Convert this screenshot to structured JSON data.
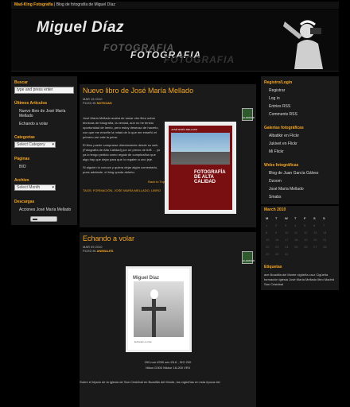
{
  "topbar": {
    "brand": "Mad-King Fotografía",
    "sep": " | ",
    "tagline": "Blog de fotografía de Miguel Díaz"
  },
  "header": {
    "name": "Miguel Díaz",
    "sub": "FOTOGRAFIA"
  },
  "left": {
    "search_title": "Buscar",
    "search_placeholder": "type and press enter",
    "recent_title": "Últimos Artículos",
    "recent": [
      "Nuevo libro de José María Mellado",
      "Echando a volar"
    ],
    "categories_title": "Categorías",
    "categories_select": "Select Category",
    "pages_title": "Páginas",
    "pages": [
      "BIO"
    ],
    "archive_title": "Archivo",
    "archive_select": "Select Month",
    "downloads_title": "Descargas",
    "downloads": [
      "Acciones José María Mellado"
    ]
  },
  "posts": [
    {
      "title": "Nuevo libro de José María Mellado",
      "date": "MAR 15 2010",
      "filed_label": "FILED IN",
      "category": "NOTICIAS",
      "badge": "GUARDAR",
      "body": [
        "José María Mellado acaba de sacar otro libro sobre técnicas de fotografía, la verdad, aún no he tenido oportunidad de leerlo, pero estoy deseoso de hacerlo, con que me enseñe la mitad de lo que me enseñó el primero me vale la pena.",
        "El libro puede comprarse directamente desde su web (Fotografía de Alta Calidad) por un precio de 64€ … yo ya lo tengo pedido como regalo de cumpleaños que algo hay que dejar para que lo regalen a uno jeje.",
        "Si alguien lo conoce y quiera dejar algún comentario, pues adelante, el blog queda abierto."
      ],
      "link_text": "Fotografía de Alta Calidad",
      "nav": "Back to Top | No Comments",
      "tags_label": "TAGS:",
      "tags": "FORMACIÓN, JOSE MARÍA MELLADO, LIBRO",
      "book": {
        "top": "JOSÉ MARÍA MELLADO",
        "title": "FOTOGRAFÍA DE ALTA CALIDAD"
      }
    },
    {
      "title": "Echando a volar",
      "date": "MAR 09 2010",
      "filed_label": "FILED IN",
      "category": "ANIMALES",
      "badge": "GUARDAR",
      "photo_title": "Miguel Díaz",
      "photo_caption": "Echando a volar",
      "exif1": "200 mm  f/250 sec  f/5.6 , ISO 200",
      "exif2": "Nikon D300 Nikkor 18-200 VRII",
      "text": "Sobre el tejado de la iglesia de San Cristóbal en Boadilla del Monte, las cigüeñas en esta época del"
    }
  ],
  "right": {
    "login_title": "Registro/Login",
    "login": [
      "Registrar",
      "Log in",
      "Entries RSS",
      "Comments RSS"
    ],
    "galleries_title": "Galerías fotográficas",
    "galleries": [
      "Albatikir en Flickr",
      "Jukivet en Flickr",
      "Mi Flickr"
    ],
    "webs_title": "Webs fotográficas",
    "webs": [
      "Blog de Juan García Gálvez",
      "Dzoom",
      "José María Mellado",
      "Smabs"
    ],
    "calendar_title": "March 2010",
    "calendar_head": [
      "M",
      "T",
      "W",
      "T",
      "F",
      "S",
      "S"
    ],
    "calendar_days": [
      "1",
      "2",
      "3",
      "4",
      "5",
      "6",
      "7",
      "8",
      "9",
      "10",
      "11",
      "12",
      "13",
      "14",
      "15",
      "16",
      "17",
      "18",
      "19",
      "20",
      "21",
      "22",
      "23",
      "24",
      "25",
      "26",
      "27",
      "28",
      "29",
      "30",
      "31"
    ],
    "tags_title": "Etiquetas",
    "tags": "ave  Boadilla del Monte  cigüeña  cruz  Cigüeña  formación  iglesia  José María Mellado  libro  Madrid  San Cristóbal"
  }
}
